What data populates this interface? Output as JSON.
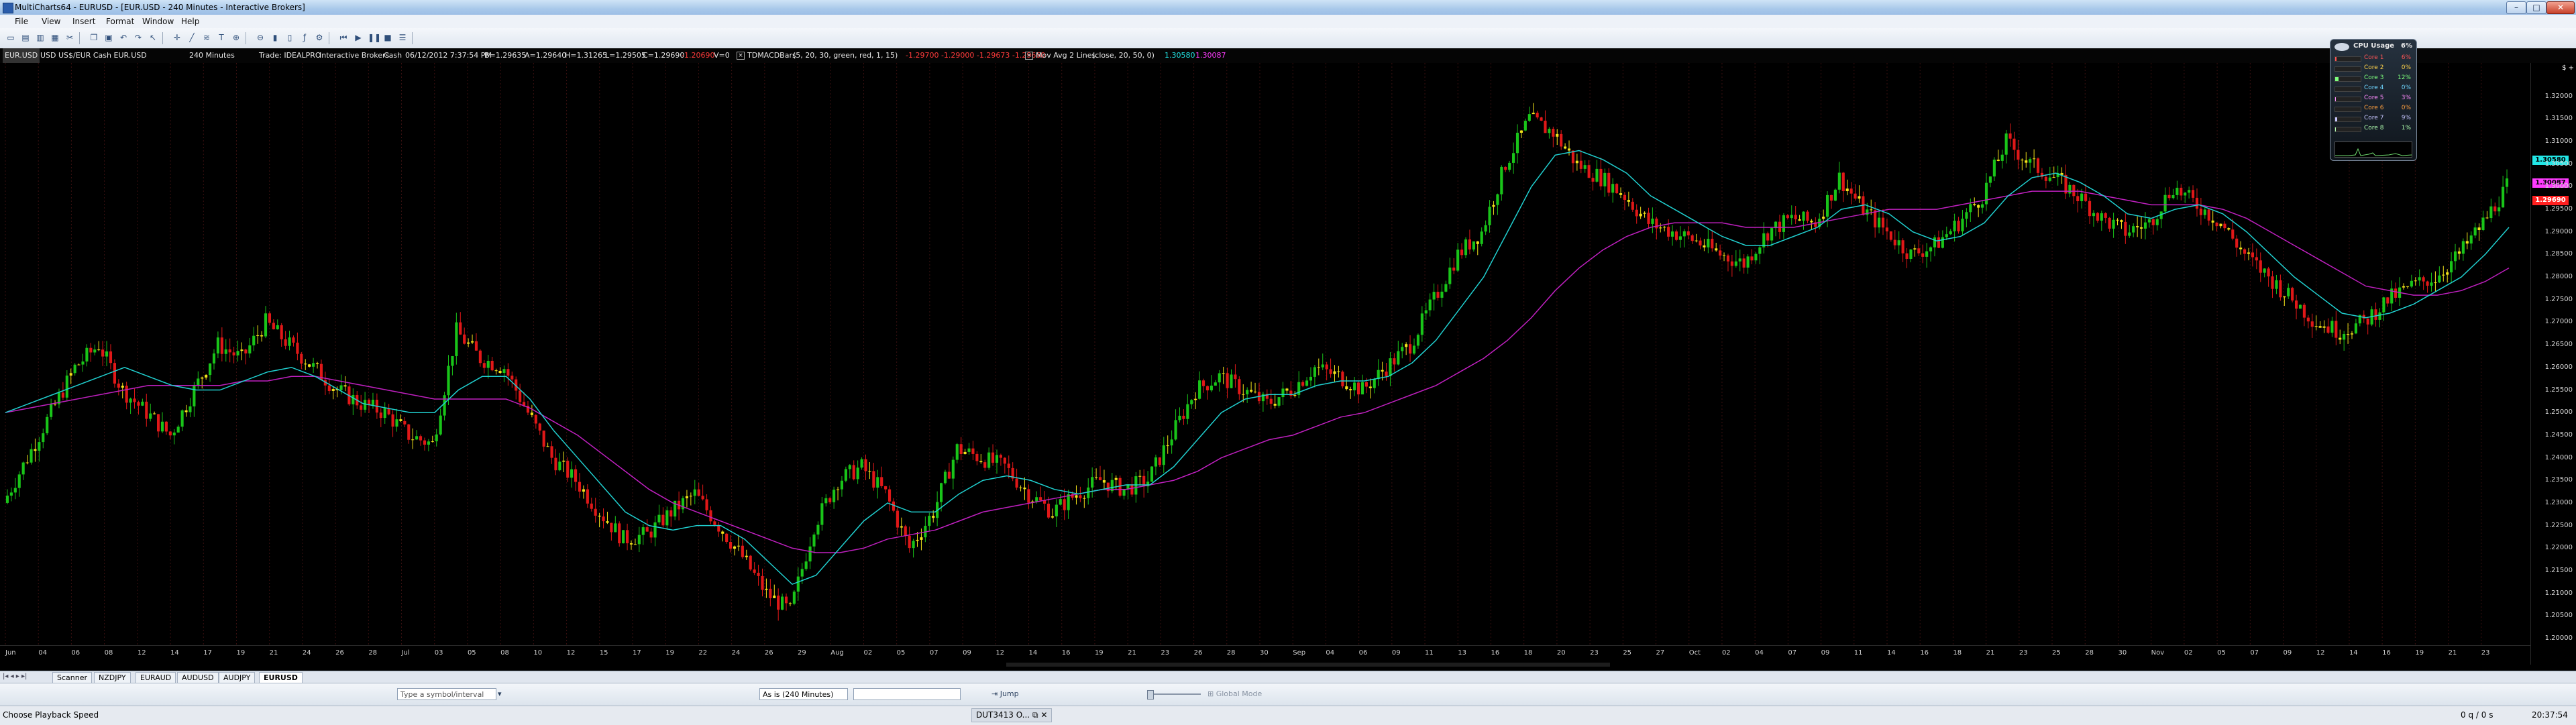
{
  "window": {
    "title": "MultiCharts64 - EURUSD - [EUR.USD - 240 Minutes - Interactive Brokers]",
    "minimize_glyph": "–",
    "maximize_glyph": "□",
    "close_glyph": "✕"
  },
  "menu": [
    "File",
    "View",
    "Insert",
    "Format",
    "Window",
    "Help"
  ],
  "toolbar_icons": [
    "new-icon",
    "open-icon",
    "save-icon",
    "print-icon",
    "cut-icon",
    "copy-icon",
    "paste-icon",
    "undo-icon",
    "redo-icon",
    "cursor-icon",
    "crosshair-icon",
    "line-icon",
    "fibonacci-icon",
    "text-icon",
    "zoom-in-icon",
    "zoom-out-icon",
    "bar-chart-icon",
    "candle-icon",
    "indicator-icon",
    "strategy-icon",
    "replay-icon",
    "play-icon",
    "pause-icon",
    "stop-icon",
    "settings-icon"
  ],
  "status_line": {
    "symbol": "EUR.USD",
    "description": "USD US$/EUR Cash EUR.USD",
    "interval": "240 Minutes",
    "trade": "Trade: IDEALPRO",
    "source": "Interactive Brokers",
    "category": "Cash",
    "datetime": "06/12/2012 7:37:54 PM",
    "bid": "B=1.29635",
    "ask": "A=1.29640",
    "high": "H=1.31265",
    "low": "L=1.29505",
    "close": "C=1.29690",
    "change": "-1.20690",
    "volume": "V=0",
    "study1_name": "TDMACDBars",
    "study1_params": "(5, 20, 30, green, red, 1, 15)",
    "study1_values": "-1.29700  -1.29000  -1.29673  -1.29660",
    "study2_name": "Mov Avg 2 Lines",
    "study2_params": "(close, 20, 50, 0)",
    "study2_v1": "1.30580",
    "study2_v2": "1.30087"
  },
  "price_axis": {
    "ticks": [
      "1.32000",
      "1.31500",
      "1.31000",
      "1.30500",
      "1.30000",
      "1.29500",
      "1.29000",
      "1.28500",
      "1.28000",
      "1.27500",
      "1.27000",
      "1.26500",
      "1.26000",
      "1.25500",
      "1.25000",
      "1.24500",
      "1.24000",
      "1.23500",
      "1.23000",
      "1.22500",
      "1.22000",
      "1.21500",
      "1.21000",
      "1.20500",
      "1.20000"
    ],
    "badge_cyan": "1.30580",
    "badge_magenta": "1.30087",
    "badge_red": "1.29690",
    "top_marker": "$ +"
  },
  "date_axis": {
    "labels": [
      "Jun",
      "04",
      "06",
      "08",
      "12",
      "14",
      "17",
      "19",
      "21",
      "24",
      "26",
      "28",
      "Jul",
      "03",
      "05",
      "08",
      "10",
      "12",
      "15",
      "17",
      "19",
      "22",
      "24",
      "26",
      "29",
      "Aug",
      "02",
      "05",
      "07",
      "09",
      "12",
      "14",
      "16",
      "19",
      "21",
      "23",
      "26",
      "28",
      "30",
      "Sep",
      "04",
      "06",
      "09",
      "11",
      "13",
      "16",
      "18",
      "20",
      "23",
      "25",
      "27",
      "Oct",
      "02",
      "04",
      "07",
      "09",
      "11",
      "14",
      "16",
      "18",
      "21",
      "23",
      "25",
      "28",
      "30",
      "Nov",
      "02",
      "05",
      "07",
      "09",
      "12",
      "14",
      "16",
      "19",
      "21",
      "23"
    ]
  },
  "cpu_widget": {
    "title": "CPU Usage",
    "total": "6%",
    "rows": [
      {
        "label": "Core 1",
        "value": "6%"
      },
      {
        "label": "Core 2",
        "value": "0%"
      },
      {
        "label": "Core 3",
        "value": "12%"
      },
      {
        "label": "Core 4",
        "value": "0%"
      },
      {
        "label": "Core 5",
        "value": "3%"
      },
      {
        "label": "Core 6",
        "value": "0%"
      },
      {
        "label": "Core 7",
        "value": "9%"
      },
      {
        "label": "Core 8",
        "value": "1%"
      }
    ]
  },
  "sheet_tabs": [
    "Scanner",
    "NZDJPY",
    "EURAUD",
    "AUDUSD",
    "AUDJPY",
    "EURUSD"
  ],
  "active_sheet": "EURUSD",
  "bottom_toolbar": {
    "symbol_placeholder": "Type a symbol/interval",
    "jump_label": "Jump",
    "interval_value": "As is (240 Minutes)",
    "global_mode": "Global Mode"
  },
  "statusbar": {
    "hint": "Choose Playback Speed",
    "taskbar_item": "DUT3413 O...",
    "queue": "0 q / 0 s",
    "clock": "20:37:54"
  },
  "colors": {
    "bull": "#19c419",
    "bear": "#e01818",
    "doji": "#f2e21a",
    "ma_fast": "#20d0d0",
    "ma_slow": "#c020c0",
    "grid": "#3a1010"
  },
  "chart_data": {
    "type": "candlestick",
    "title": "EUR.USD 240 Minutes",
    "ylim": [
      1.2,
      1.325
    ],
    "xlabel": "",
    "ylabel": "",
    "price_path": [
      1.23,
      1.24,
      1.25,
      1.26,
      1.265,
      1.255,
      1.25,
      1.245,
      1.255,
      1.265,
      1.262,
      1.27,
      1.265,
      1.26,
      1.255,
      1.252,
      1.25,
      1.245,
      1.243,
      1.268,
      1.262,
      1.26,
      1.25,
      1.24,
      1.235,
      1.228,
      1.222,
      1.223,
      1.228,
      1.232,
      1.225,
      1.218,
      1.21,
      1.206,
      1.225,
      1.235,
      1.238,
      1.232,
      1.22,
      1.228,
      1.242,
      1.24,
      1.238,
      1.232,
      1.228,
      1.232,
      1.235,
      1.233,
      1.235,
      1.245,
      1.255,
      1.258,
      1.255,
      1.252,
      1.255,
      1.26,
      1.258,
      1.255,
      1.26,
      1.265,
      1.275,
      1.285,
      1.29,
      1.305,
      1.315,
      1.312,
      1.305,
      1.302,
      1.298,
      1.292,
      1.29,
      1.288,
      1.285,
      1.283,
      1.29,
      1.293,
      1.292,
      1.302,
      1.295,
      1.29,
      1.285,
      1.287,
      1.292,
      1.298,
      1.31,
      1.305,
      1.302,
      1.298,
      1.293,
      1.29,
      1.292,
      1.3,
      1.296,
      1.292,
      1.285,
      1.28,
      1.275,
      1.27,
      1.268,
      1.27,
      1.275,
      1.278,
      1.28,
      1.285,
      1.292,
      1.3
    ],
    "ma_fast": [
      1.25,
      1.252,
      1.254,
      1.256,
      1.258,
      1.26,
      1.258,
      1.256,
      1.255,
      1.255,
      1.257,
      1.259,
      1.26,
      1.258,
      1.255,
      1.252,
      1.251,
      1.25,
      1.25,
      1.255,
      1.258,
      1.258,
      1.253,
      1.246,
      1.24,
      1.234,
      1.228,
      1.225,
      1.224,
      1.225,
      1.225,
      1.222,
      1.217,
      1.212,
      1.214,
      1.22,
      1.226,
      1.23,
      1.228,
      1.228,
      1.232,
      1.235,
      1.236,
      1.235,
      1.233,
      1.232,
      1.233,
      1.234,
      1.234,
      1.238,
      1.244,
      1.25,
      1.253,
      1.254,
      1.254,
      1.256,
      1.257,
      1.257,
      1.258,
      1.261,
      1.266,
      1.273,
      1.28,
      1.29,
      1.3,
      1.307,
      1.308,
      1.306,
      1.303,
      1.298,
      1.295,
      1.292,
      1.289,
      1.287,
      1.287,
      1.289,
      1.291,
      1.295,
      1.296,
      1.294,
      1.29,
      1.288,
      1.289,
      1.292,
      1.298,
      1.302,
      1.303,
      1.301,
      1.298,
      1.294,
      1.293,
      1.295,
      1.296,
      1.294,
      1.29,
      1.285,
      1.28,
      1.276,
      1.272,
      1.271,
      1.272,
      1.274,
      1.277,
      1.28,
      1.285,
      1.291
    ],
    "ma_slow": [
      1.25,
      1.251,
      1.252,
      1.253,
      1.254,
      1.255,
      1.256,
      1.256,
      1.256,
      1.256,
      1.257,
      1.257,
      1.258,
      1.258,
      1.257,
      1.256,
      1.255,
      1.254,
      1.253,
      1.253,
      1.253,
      1.253,
      1.251,
      1.248,
      1.245,
      1.241,
      1.237,
      1.233,
      1.23,
      1.228,
      1.226,
      1.224,
      1.222,
      1.22,
      1.219,
      1.219,
      1.22,
      1.222,
      1.223,
      1.224,
      1.226,
      1.228,
      1.229,
      1.23,
      1.231,
      1.232,
      1.233,
      1.233,
      1.234,
      1.235,
      1.237,
      1.24,
      1.242,
      1.244,
      1.245,
      1.247,
      1.249,
      1.25,
      1.252,
      1.254,
      1.256,
      1.259,
      1.262,
      1.266,
      1.271,
      1.277,
      1.282,
      1.286,
      1.289,
      1.291,
      1.292,
      1.292,
      1.292,
      1.291,
      1.291,
      1.291,
      1.292,
      1.293,
      1.294,
      1.295,
      1.295,
      1.295,
      1.296,
      1.297,
      1.298,
      1.299,
      1.299,
      1.299,
      1.298,
      1.297,
      1.296,
      1.296,
      1.296,
      1.295,
      1.293,
      1.29,
      1.287,
      1.284,
      1.281,
      1.278,
      1.277,
      1.276,
      1.276,
      1.277,
      1.279,
      1.282
    ]
  }
}
